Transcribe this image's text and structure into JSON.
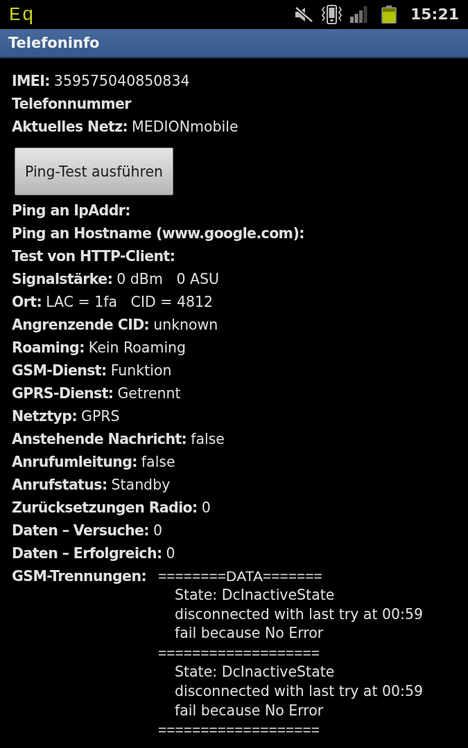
{
  "status_bar": {
    "notification_text": "Eq",
    "time": "15:21"
  },
  "title_bar": {
    "title": "Telefoninfo"
  },
  "info": [
    {
      "label": "IMEI:",
      "value": "359575040850834"
    },
    {
      "label": "Telefonnummer"
    },
    {
      "label": "Aktuelles Netz:",
      "value": "MEDIONmobile"
    }
  ],
  "ping_test_button": {
    "label": "Ping-Test ausführen"
  },
  "results": [
    {
      "label": "Ping an IpAddr:"
    },
    {
      "label": "Ping an Hostname (www.google.com):"
    },
    {
      "label": "Test von HTTP-Client:"
    },
    {
      "label": "Signalstärke:",
      "value": "0 dBm   0 ASU"
    },
    {
      "label": "Ort:",
      "value": "LAC = 1fa   CID = 4812"
    },
    {
      "label": "Angrenzende CID:",
      "value": "unknown"
    },
    {
      "label": "Roaming:",
      "value": "Kein Roaming"
    },
    {
      "label": "GSM-Dienst:",
      "value": "Funktion"
    },
    {
      "label": "GPRS-Dienst:",
      "value": "Getrennt"
    },
    {
      "label": "Netztyp:",
      "value": "GPRS"
    },
    {
      "label": "Anstehende Nachricht:",
      "value": "false"
    },
    {
      "label": "Anrufumleitung:",
      "value": "false"
    },
    {
      "label": "Anrufstatus:",
      "value": "Standby"
    },
    {
      "label": "Zurücksetzungen Radio:",
      "value": "0"
    },
    {
      "label": "Daten – Versuche:",
      "value": "0"
    },
    {
      "label": "Daten – Erfolgreich:",
      "value": "0"
    }
  ],
  "gsm_disconnects": {
    "label": "GSM-Trennungen:",
    "lines": [
      {
        "kind": "separator",
        "text": "========DATA======="
      },
      {
        "kind": "entry",
        "text": "State: DcInactiveState"
      },
      {
        "kind": "entry",
        "text": "disconnected with last try at 00:59"
      },
      {
        "kind": "entry",
        "text": "fail because No Error"
      },
      {
        "kind": "separator",
        "text": "==================="
      },
      {
        "kind": "entry",
        "text": "State: DcInactiveState"
      },
      {
        "kind": "entry",
        "text": "disconnected with last try at 00:59"
      },
      {
        "kind": "entry",
        "text": "fail because No Error"
      },
      {
        "kind": "separator",
        "text": "==================="
      }
    ]
  }
}
